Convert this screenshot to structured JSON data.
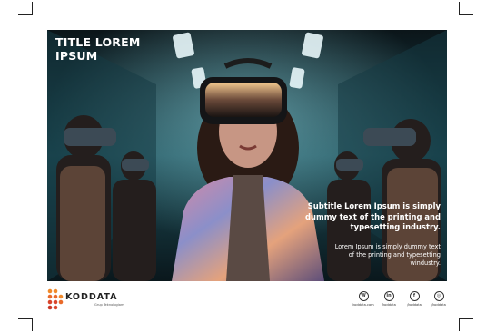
{
  "poster": {
    "title": "TITLE LOREM IPSUM",
    "subtitle": "Subtitle Lorem Ipsum is simply dummy text of the printing and typesetting industry.",
    "body": "Lorem Ipsum is simply dummy text of the printing and typesetting windustry."
  },
  "brand": {
    "name": "KODDATA",
    "tagline": "Grup Teknologiam"
  },
  "social": [
    {
      "icon": "website-icon",
      "glyph": "W",
      "label": "koddata.com"
    },
    {
      "icon": "linkedin-icon",
      "glyph": "in",
      "label": "/koddata"
    },
    {
      "icon": "facebook-icon",
      "glyph": "f",
      "label": "/koddata"
    },
    {
      "icon": "instagram-icon",
      "glyph": "◎",
      "label": "/koddata"
    }
  ],
  "colors": {
    "logo_orange": "#f0892a",
    "logo_red": "#d9452b",
    "photo_teal": "#2a6e7a"
  }
}
